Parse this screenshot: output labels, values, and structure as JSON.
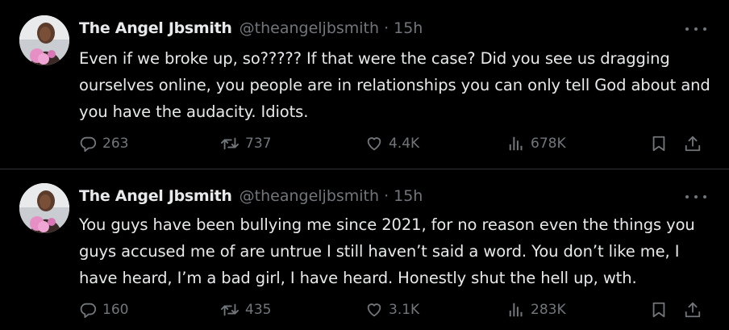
{
  "theme": {
    "background": "#000000",
    "text_primary": "#e7e9ea",
    "text_secondary": "#71767b",
    "divider": "#2f3336"
  },
  "tweets": [
    {
      "display_name": "The Angel Jbsmith",
      "handle": "@theangeljbsmith",
      "separator": "·",
      "time": "15h",
      "text": "Even if we broke up, so????? If that were the case? Did you see us dragging ourselves online, you people are in relationships you can only tell God about and you have the audacity. Idiots.",
      "replies": "263",
      "reposts": "737",
      "likes": "4.4K",
      "views": "678K",
      "icons": {
        "reply": "reply-bubble-icon",
        "repost": "repost-arrows-icon",
        "like": "heart-icon",
        "views": "bar-chart-views-icon",
        "bookmark": "bookmark-icon",
        "share": "share-upload-icon",
        "more": "more-dots-icon"
      }
    },
    {
      "display_name": "The Angel Jbsmith",
      "handle": "@theangeljbsmith",
      "separator": "·",
      "time": "15h",
      "text": "You guys have been bullying me since 2021, for no reason even the things you guys accused me of are untrue I still haven’t said a word. You don’t like me, I have heard, I’m a bad girl, I have heard. Honestly shut the hell up, wth.",
      "replies": "160",
      "reposts": "435",
      "likes": "3.1K",
      "views": "283K",
      "icons": {
        "reply": "reply-bubble-icon",
        "repost": "repost-arrows-icon",
        "like": "heart-icon",
        "views": "bar-chart-views-icon",
        "bookmark": "bookmark-icon",
        "share": "share-upload-icon",
        "more": "more-dots-icon"
      }
    }
  ]
}
